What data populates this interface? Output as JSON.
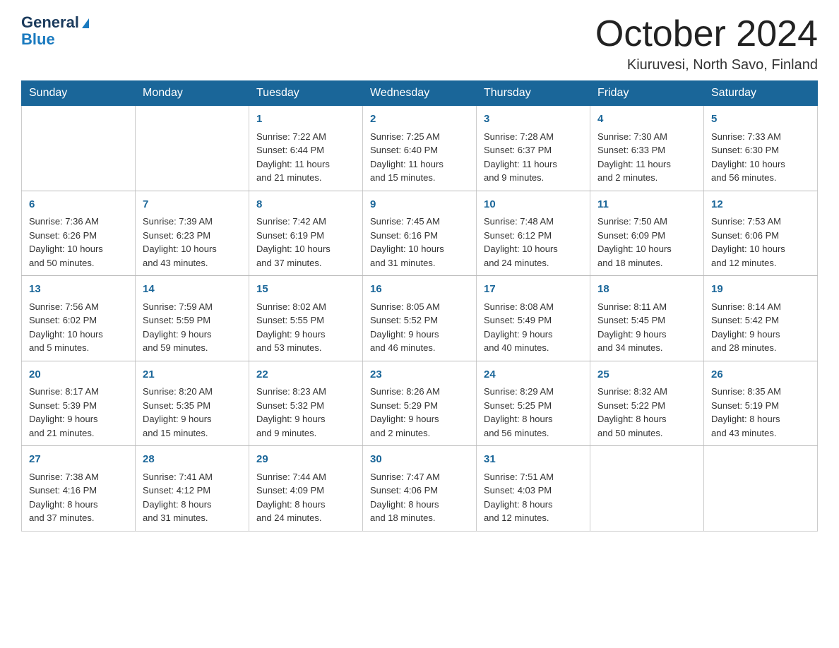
{
  "logo": {
    "general": "General",
    "blue": "Blue"
  },
  "title": "October 2024",
  "location": "Kiuruvesi, North Savo, Finland",
  "days_of_week": [
    "Sunday",
    "Monday",
    "Tuesday",
    "Wednesday",
    "Thursday",
    "Friday",
    "Saturday"
  ],
  "weeks": [
    [
      {
        "day": "",
        "info": ""
      },
      {
        "day": "",
        "info": ""
      },
      {
        "day": "1",
        "info": "Sunrise: 7:22 AM\nSunset: 6:44 PM\nDaylight: 11 hours\nand 21 minutes."
      },
      {
        "day": "2",
        "info": "Sunrise: 7:25 AM\nSunset: 6:40 PM\nDaylight: 11 hours\nand 15 minutes."
      },
      {
        "day": "3",
        "info": "Sunrise: 7:28 AM\nSunset: 6:37 PM\nDaylight: 11 hours\nand 9 minutes."
      },
      {
        "day": "4",
        "info": "Sunrise: 7:30 AM\nSunset: 6:33 PM\nDaylight: 11 hours\nand 2 minutes."
      },
      {
        "day": "5",
        "info": "Sunrise: 7:33 AM\nSunset: 6:30 PM\nDaylight: 10 hours\nand 56 minutes."
      }
    ],
    [
      {
        "day": "6",
        "info": "Sunrise: 7:36 AM\nSunset: 6:26 PM\nDaylight: 10 hours\nand 50 minutes."
      },
      {
        "day": "7",
        "info": "Sunrise: 7:39 AM\nSunset: 6:23 PM\nDaylight: 10 hours\nand 43 minutes."
      },
      {
        "day": "8",
        "info": "Sunrise: 7:42 AM\nSunset: 6:19 PM\nDaylight: 10 hours\nand 37 minutes."
      },
      {
        "day": "9",
        "info": "Sunrise: 7:45 AM\nSunset: 6:16 PM\nDaylight: 10 hours\nand 31 minutes."
      },
      {
        "day": "10",
        "info": "Sunrise: 7:48 AM\nSunset: 6:12 PM\nDaylight: 10 hours\nand 24 minutes."
      },
      {
        "day": "11",
        "info": "Sunrise: 7:50 AM\nSunset: 6:09 PM\nDaylight: 10 hours\nand 18 minutes."
      },
      {
        "day": "12",
        "info": "Sunrise: 7:53 AM\nSunset: 6:06 PM\nDaylight: 10 hours\nand 12 minutes."
      }
    ],
    [
      {
        "day": "13",
        "info": "Sunrise: 7:56 AM\nSunset: 6:02 PM\nDaylight: 10 hours\nand 5 minutes."
      },
      {
        "day": "14",
        "info": "Sunrise: 7:59 AM\nSunset: 5:59 PM\nDaylight: 9 hours\nand 59 minutes."
      },
      {
        "day": "15",
        "info": "Sunrise: 8:02 AM\nSunset: 5:55 PM\nDaylight: 9 hours\nand 53 minutes."
      },
      {
        "day": "16",
        "info": "Sunrise: 8:05 AM\nSunset: 5:52 PM\nDaylight: 9 hours\nand 46 minutes."
      },
      {
        "day": "17",
        "info": "Sunrise: 8:08 AM\nSunset: 5:49 PM\nDaylight: 9 hours\nand 40 minutes."
      },
      {
        "day": "18",
        "info": "Sunrise: 8:11 AM\nSunset: 5:45 PM\nDaylight: 9 hours\nand 34 minutes."
      },
      {
        "day": "19",
        "info": "Sunrise: 8:14 AM\nSunset: 5:42 PM\nDaylight: 9 hours\nand 28 minutes."
      }
    ],
    [
      {
        "day": "20",
        "info": "Sunrise: 8:17 AM\nSunset: 5:39 PM\nDaylight: 9 hours\nand 21 minutes."
      },
      {
        "day": "21",
        "info": "Sunrise: 8:20 AM\nSunset: 5:35 PM\nDaylight: 9 hours\nand 15 minutes."
      },
      {
        "day": "22",
        "info": "Sunrise: 8:23 AM\nSunset: 5:32 PM\nDaylight: 9 hours\nand 9 minutes."
      },
      {
        "day": "23",
        "info": "Sunrise: 8:26 AM\nSunset: 5:29 PM\nDaylight: 9 hours\nand 2 minutes."
      },
      {
        "day": "24",
        "info": "Sunrise: 8:29 AM\nSunset: 5:25 PM\nDaylight: 8 hours\nand 56 minutes."
      },
      {
        "day": "25",
        "info": "Sunrise: 8:32 AM\nSunset: 5:22 PM\nDaylight: 8 hours\nand 50 minutes."
      },
      {
        "day": "26",
        "info": "Sunrise: 8:35 AM\nSunset: 5:19 PM\nDaylight: 8 hours\nand 43 minutes."
      }
    ],
    [
      {
        "day": "27",
        "info": "Sunrise: 7:38 AM\nSunset: 4:16 PM\nDaylight: 8 hours\nand 37 minutes."
      },
      {
        "day": "28",
        "info": "Sunrise: 7:41 AM\nSunset: 4:12 PM\nDaylight: 8 hours\nand 31 minutes."
      },
      {
        "day": "29",
        "info": "Sunrise: 7:44 AM\nSunset: 4:09 PM\nDaylight: 8 hours\nand 24 minutes."
      },
      {
        "day": "30",
        "info": "Sunrise: 7:47 AM\nSunset: 4:06 PM\nDaylight: 8 hours\nand 18 minutes."
      },
      {
        "day": "31",
        "info": "Sunrise: 7:51 AM\nSunset: 4:03 PM\nDaylight: 8 hours\nand 12 minutes."
      },
      {
        "day": "",
        "info": ""
      },
      {
        "day": "",
        "info": ""
      }
    ]
  ]
}
